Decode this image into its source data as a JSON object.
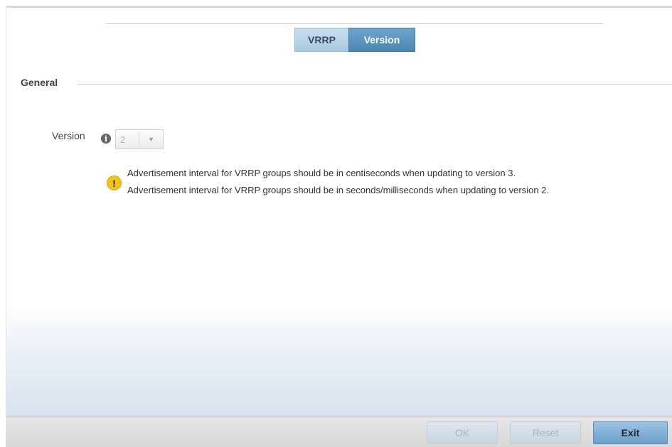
{
  "tabs": [
    {
      "label": "VRRP",
      "active": false
    },
    {
      "label": "Version",
      "active": true
    }
  ],
  "section": {
    "title": "General"
  },
  "version_field": {
    "label": "Version",
    "info_icon": "info-icon",
    "value": "2"
  },
  "warning": {
    "icon": "warning-icon",
    "line1": "Advertisement interval for VRRP groups should be in centiseconds when updating to version 3.",
    "line2": "Advertisement interval for VRRP groups should be in seconds/milliseconds when updating to version 2."
  },
  "buttons": {
    "ok": "OK",
    "reset": "Reset",
    "exit": "Exit"
  },
  "colors": {
    "tab_active": "#4a86b3",
    "tab_inactive": "#a9c9e0",
    "warning": "#f2c41a",
    "exit_button": "#6a9fcb"
  }
}
